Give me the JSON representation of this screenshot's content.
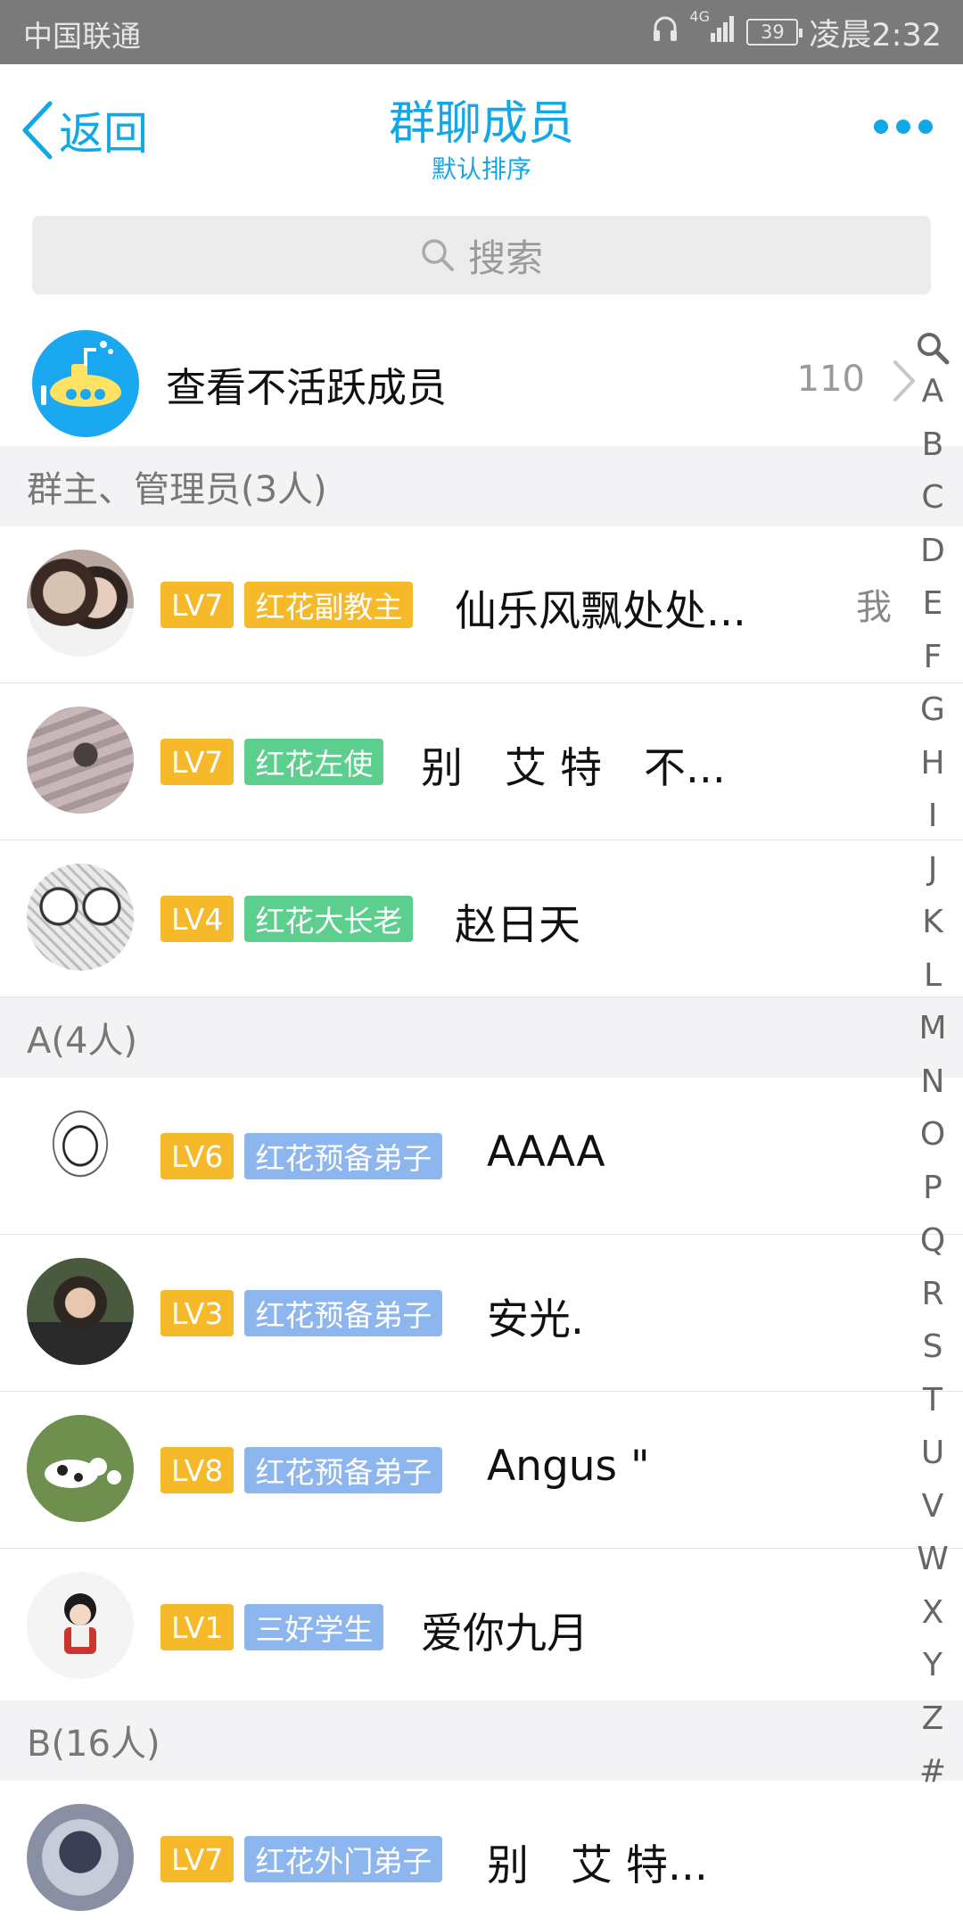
{
  "status_bar": {
    "carrier": "中国联通",
    "network": "4G",
    "battery": "39",
    "time": "凌晨2:32"
  },
  "nav": {
    "back_label": "返回",
    "title": "群聊成员",
    "subtitle": "默认排序"
  },
  "search": {
    "placeholder": "搜索"
  },
  "inactive": {
    "label": "查看不活跃成员",
    "count": "110"
  },
  "sections": [
    {
      "header": "群主、管理员(3人)"
    },
    {
      "header": "A(4人)"
    },
    {
      "header": "B(16人)"
    }
  ],
  "members": [
    {
      "level": "LV7",
      "title": "红花副教主",
      "title_color": "#f5b92a",
      "name": "仙乐风飘处处...",
      "me_label": "我"
    },
    {
      "level": "LV7",
      "title": "红花左使",
      "title_color": "#5ccf8e",
      "name": "别　艾 特　不..."
    },
    {
      "level": "LV4",
      "title": "红花大长老",
      "title_color": "#5ccf8e",
      "name": "赵日天"
    },
    {
      "level": "LV6",
      "title": "红花预备弟子",
      "title_color": "#8db6ef",
      "name": "AAAA"
    },
    {
      "level": "LV3",
      "title": "红花预备弟子",
      "title_color": "#8db6ef",
      "name": "安光."
    },
    {
      "level": "LV8",
      "title": "红花预备弟子",
      "title_color": "#8db6ef",
      "name": "Angus \""
    },
    {
      "level": "LV1",
      "title": "三好学生",
      "title_color": "#8db6ef",
      "name": "爱你九月"
    },
    {
      "level": "LV7",
      "title": "红花外门弟子",
      "title_color": "#8db6ef",
      "name": "别　艾 特..."
    }
  ],
  "index_letters": [
    "A",
    "B",
    "C",
    "D",
    "E",
    "F",
    "G",
    "H",
    "I",
    "J",
    "K",
    "L",
    "M",
    "N",
    "O",
    "P",
    "Q",
    "R",
    "S",
    "T",
    "U",
    "V",
    "W",
    "X",
    "Y",
    "Z",
    "#"
  ],
  "colors": {
    "accent": "#12a8e8",
    "level_badge": "#f5b92a",
    "section_bg": "#f3f3f5"
  },
  "icons": {
    "back": "chevron-left-icon",
    "more": "more-dots-icon",
    "search": "search-icon",
    "index_search": "search-icon"
  }
}
